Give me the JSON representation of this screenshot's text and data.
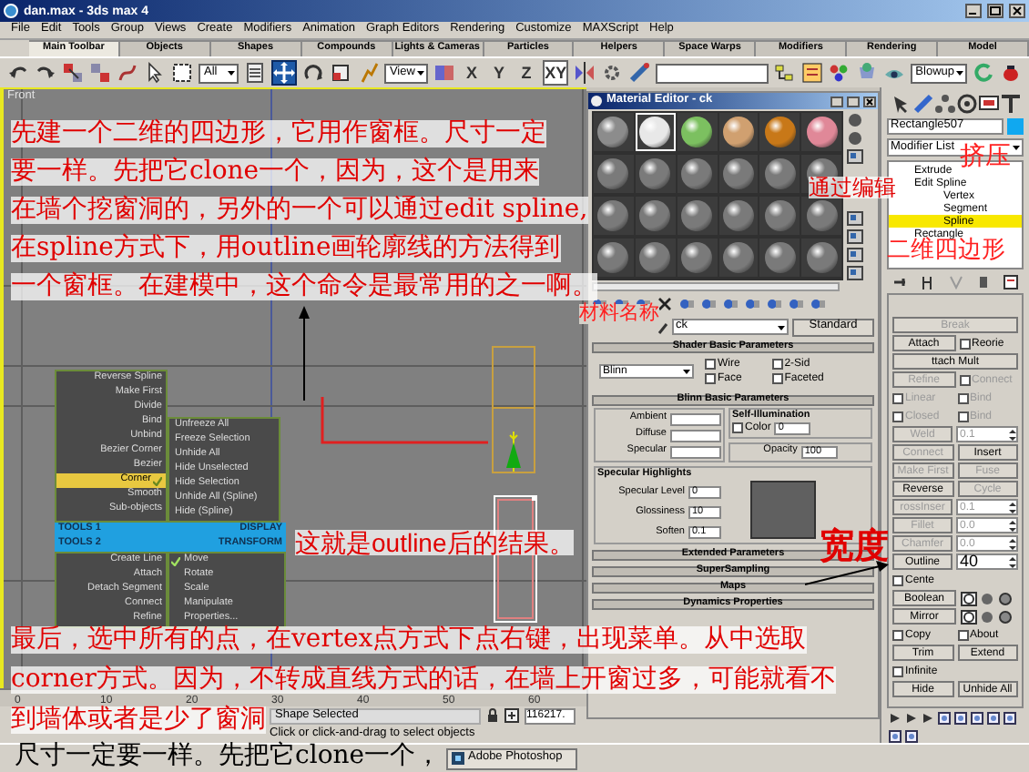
{
  "window": {
    "title": "dan.max - 3ds max 4"
  },
  "menu_bar": [
    "File",
    "Edit",
    "Tools",
    "Group",
    "Views",
    "Create",
    "Modifiers",
    "Animation",
    "Graph Editors",
    "Rendering",
    "Customize",
    "MAXScript",
    "Help"
  ],
  "tab_bar": [
    {
      "label": "Main Toolbar",
      "selected": true
    },
    {
      "label": "Objects",
      "selected": false
    },
    {
      "label": "Shapes",
      "selected": false
    },
    {
      "label": "Compounds",
      "selected": false
    },
    {
      "label": "Lights & Cameras",
      "selected": false
    },
    {
      "label": "Particles",
      "selected": false
    },
    {
      "label": "Helpers",
      "selected": false
    },
    {
      "label": "Space Warps",
      "selected": false
    },
    {
      "label": "Modifiers",
      "selected": false
    },
    {
      "label": "Rendering",
      "selected": false
    },
    {
      "label": "Model",
      "selected": false
    }
  ],
  "toolbar": {
    "selection_filter": "All",
    "transform_tools": [
      {
        "kind": "move",
        "selected": true
      },
      {
        "kind": "rotate",
        "selected": false
      },
      {
        "kind": "scale",
        "selected": false
      }
    ],
    "reference_coord": "View",
    "axis_buttons": [
      {
        "label": "X",
        "selected": false
      },
      {
        "label": "Y",
        "selected": false
      },
      {
        "label": "Z",
        "selected": false
      },
      {
        "label": "XY",
        "selected": true
      }
    ],
    "render_type": "Blowup"
  },
  "viewport": {
    "label": "Front",
    "active": true
  },
  "quad_menu": {
    "tools1_items": [
      {
        "label": "Reverse Spline",
        "selected": false
      },
      {
        "label": "Make First",
        "selected": false
      },
      {
        "label": "Divide",
        "selected": false
      },
      {
        "label": "Bind",
        "selected": false
      },
      {
        "label": "Unbind",
        "selected": false
      },
      {
        "label": "Bezier Corner",
        "selected": false
      },
      {
        "label": "Bezier",
        "selected": false
      },
      {
        "label": "Corner",
        "selected": true
      },
      {
        "label": "Smooth",
        "selected": false
      },
      {
        "label": "Sub-objects",
        "selected": false
      }
    ],
    "display_items": [
      "Unfreeze All",
      "Freeze Selection",
      "Unhide All",
      "Hide Unselected",
      "Hide Selection",
      "Unhide All (Spline)",
      "Hide (Spline)"
    ],
    "tools1_header": "TOOLS 1",
    "display_header": "DISPLAY",
    "tools2_header": "TOOLS 2",
    "transform_header": "TRANSFORM",
    "tools2_items": [
      "Create Line",
      "Attach",
      "Detach Segment",
      "Connect",
      "Refine"
    ],
    "transform_items": [
      {
        "label": "Move",
        "checked": true
      },
      {
        "label": "Rotate",
        "checked": false
      },
      {
        "label": "Scale",
        "checked": false
      },
      {
        "label": "Manipulate",
        "checked": false
      },
      {
        "label": "Properties...",
        "checked": false
      }
    ]
  },
  "material_editor": {
    "title": "Material Editor - ck",
    "samples": [
      {
        "color": "#8c8c8c",
        "selected": false
      },
      {
        "color": "#e8e8e8",
        "selected": true
      },
      {
        "color": "#7cc060",
        "selected": false
      },
      {
        "color": "#d0a070",
        "selected": false
      },
      {
        "color": "#c87818",
        "selected": false
      },
      {
        "color": "#e08898",
        "selected": false
      },
      {
        "color": "#7a7a7a",
        "selected": false
      },
      {
        "color": "#7a7a7a",
        "selected": false
      },
      {
        "color": "#7a7a7a",
        "selected": false
      },
      {
        "color": "#7a7a7a",
        "selected": false
      },
      {
        "color": "#7a7a7a",
        "selected": false
      },
      {
        "color": "#7a7a7a",
        "selected": false
      },
      {
        "color": "#7a7a7a",
        "selected": false
      },
      {
        "color": "#7a7a7a",
        "selected": false
      },
      {
        "color": "#7a7a7a",
        "selected": false
      },
      {
        "color": "#7a7a7a",
        "selected": false
      },
      {
        "color": "#7a7a7a",
        "selected": false
      },
      {
        "color": "#7a7a7a",
        "selected": false
      },
      {
        "color": "#7a7a7a",
        "selected": false
      },
      {
        "color": "#7a7a7a",
        "selected": false
      },
      {
        "color": "#7a7a7a",
        "selected": false
      },
      {
        "color": "#7a7a7a",
        "selected": false
      },
      {
        "color": "#7a7a7a",
        "selected": false
      },
      {
        "color": "#7a7a7a",
        "selected": false
      }
    ],
    "material_name": "ck",
    "material_type": "Standard",
    "shader_rollout": {
      "title": "Shader Basic Parameters",
      "shader": "Blinn",
      "options": [
        {
          "label": "Wire",
          "checked": false
        },
        {
          "label": "2-Sid",
          "checked": false
        },
        {
          "label": "Face",
          "checked": false
        },
        {
          "label": "Faceted",
          "checked": false
        }
      ]
    },
    "blinn_rollout": {
      "title": "Blinn Basic Parameters",
      "color_slots": [
        "Ambient",
        "Diffuse",
        "Specular"
      ],
      "self_illumination": {
        "title": "Self-Illumination",
        "label": "Color",
        "checked": false,
        "value": "0"
      },
      "opacity": {
        "label": "Opacity",
        "value": "100"
      },
      "specular_highlights": {
        "title": "Specular Highlights",
        "fields": [
          {
            "label": "Specular Level",
            "value": "0"
          },
          {
            "label": "Glossiness",
            "value": "10"
          },
          {
            "label": "Soften",
            "value": "0.1"
          }
        ]
      }
    },
    "collapsed_rollouts": [
      "Extended Parameters",
      "SuperSampling",
      "Maps",
      "Dynamics Properties"
    ]
  },
  "command_panel": {
    "object_name": "Rectangle507",
    "modifier_list": "Modifier List",
    "stack": [
      {
        "label": "Extrude",
        "selected": false
      },
      {
        "label": "Edit Spline",
        "selected": false,
        "children": [
          {
            "label": "Vertex",
            "selected": false
          },
          {
            "label": "Segment",
            "selected": false
          },
          {
            "label": "Spline",
            "selected": true
          }
        ]
      },
      {
        "label": "Rectangle",
        "selected": false
      }
    ],
    "rows": [
      [
        {
          "kind": "button",
          "label": "Break",
          "disabled": true
        }
      ],
      [
        {
          "kind": "button",
          "label": "Attach",
          "disabled": false
        },
        {
          "kind": "checkbox",
          "label": "Reorie",
          "checked": false,
          "disabled": false
        }
      ],
      [
        {
          "kind": "button",
          "label": "ttach Mult",
          "disabled": false
        }
      ],
      [
        {
          "kind": "button",
          "label": "Refine",
          "disabled": true
        },
        {
          "kind": "checkbox",
          "label": "Connect",
          "checked": false,
          "disabled": true
        }
      ],
      [
        {
          "kind": "checkbox",
          "label": "Linear",
          "checked": false,
          "disabled": true
        },
        {
          "kind": "checkbox",
          "label": "Bind",
          "checked": false,
          "disabled": true
        }
      ],
      [
        {
          "kind": "checkbox",
          "label": "Closed",
          "checked": false,
          "disabled": true
        },
        {
          "kind": "checkbox",
          "label": "Bind",
          "checked": false,
          "disabled": true
        }
      ],
      [
        {
          "kind": "button",
          "label": "Weld",
          "disabled": true
        },
        {
          "kind": "spinner",
          "value": "0.1",
          "disabled": true
        }
      ],
      [
        {
          "kind": "button",
          "label": "Connect",
          "disabled": true
        },
        {
          "kind": "button",
          "label": "Insert",
          "disabled": false
        }
      ],
      [
        {
          "kind": "button",
          "label": "Make First",
          "disabled": true
        },
        {
          "kind": "button",
          "label": "Fuse",
          "disabled": true
        }
      ],
      [
        {
          "kind": "button",
          "label": "Reverse",
          "disabled": false
        },
        {
          "kind": "button",
          "label": "Cycle",
          "disabled": true
        }
      ],
      [
        {
          "kind": "button",
          "label": "rossInser",
          "disabled": true
        },
        {
          "kind": "spinner",
          "value": "0.1",
          "disabled": true
        }
      ],
      [
        {
          "kind": "button",
          "label": "Fillet",
          "disabled": true
        },
        {
          "kind": "spinner",
          "value": "0.0",
          "disabled": true
        }
      ],
      [
        {
          "kind": "button",
          "label": "Chamfer",
          "disabled": true
        },
        {
          "kind": "spinner",
          "value": "0.0",
          "disabled": true
        }
      ],
      [
        {
          "kind": "button",
          "label": "Outline",
          "disabled": false
        },
        {
          "kind": "spinner",
          "value": "40",
          "disabled": false
        }
      ],
      [
        {
          "kind": "checkbox",
          "label": "Cente",
          "checked": false,
          "disabled": false
        }
      ],
      [
        {
          "kind": "button",
          "label": "Boolean",
          "disabled": false
        },
        {
          "kind": "icons",
          "disabled": false
        }
      ],
      [
        {
          "kind": "button",
          "label": "Mirror",
          "disabled": false
        },
        {
          "kind": "icons",
          "disabled": false
        }
      ],
      [
        {
          "kind": "checkbox",
          "label": "Copy",
          "checked": false,
          "disabled": false
        },
        {
          "kind": "checkbox",
          "label": "About",
          "checked": false,
          "disabled": false
        }
      ],
      [
        {
          "kind": "button",
          "label": "Trim",
          "disabled": false
        },
        {
          "kind": "button",
          "label": "Extend",
          "disabled": false
        }
      ],
      [
        {
          "kind": "checkbox",
          "label": "Infinite",
          "checked": false,
          "disabled": false
        }
      ],
      [
        {
          "kind": "button",
          "label": "Hide",
          "disabled": false
        },
        {
          "kind": "button",
          "label": "Unhide All",
          "disabled": false
        }
      ]
    ]
  },
  "timeline": {
    "ticks": [
      "0",
      "10",
      "20",
      "30",
      "40",
      "50",
      "60"
    ]
  },
  "status_bar": {
    "selection": "Shape Selected",
    "coordinate": "116217.",
    "prompt": "Click or click-and-drag to select objects"
  },
  "taskbar": [
    "Adobe Photoshop"
  ],
  "annotations": {
    "intro": [
      "先建一个二维的四边形，它用作窗框。尺寸一定",
      "要一样。先把它clone一个，因为，这个是用来",
      "在墙个挖窗洞的，另外的一个可以通过edit spline,",
      "在spline方式下，用outline画轮廓线的方法得到",
      "一个窗框。在建模中，这个命令是最常用的之一啊。"
    ],
    "material_name_note": "材料名称",
    "extrude_note": "挤压",
    "edit_note": "通过编辑",
    "shape_note": "二维四边形",
    "result_note": "这就是outline后的结果。",
    "width_note": "宽度",
    "final_note": [
      "最后，选中所有的点，在vertex点方式下点右键，出现菜单。从中选取",
      "corner方式。因为，不转成直线方式的话，在墙上开窗过多，可能就看不",
      "到墙体或者是少了窗洞"
    ],
    "caption": "尺寸一定要一样。先把它clone一个，"
  }
}
